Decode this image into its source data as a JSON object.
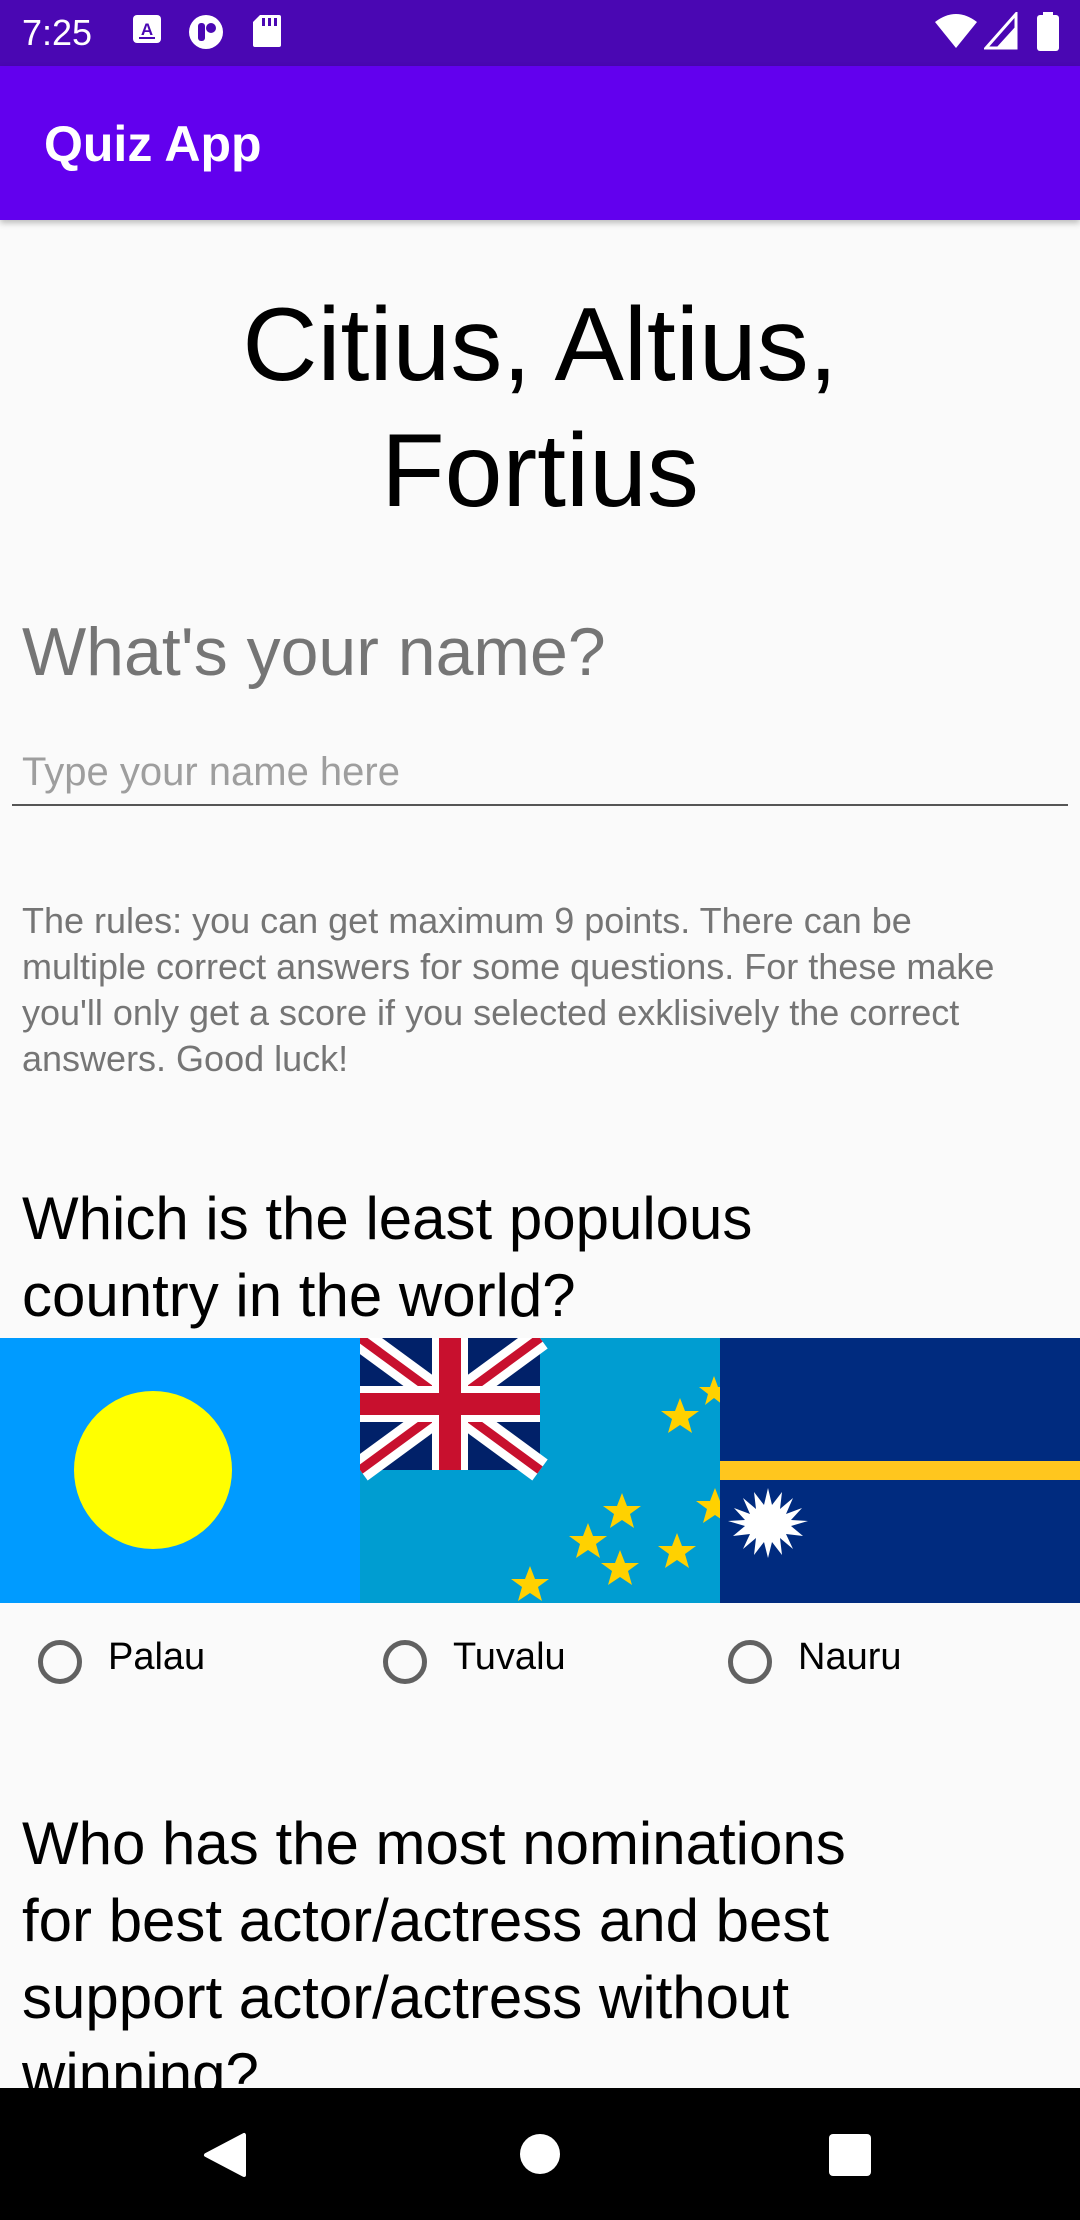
{
  "status_bar": {
    "time": "7:25",
    "left_icons": [
      "text-notification-icon",
      "app-notification-icon",
      "sd-card-icon"
    ],
    "right_icons": [
      "wifi-icon",
      "cell-signal-icon",
      "battery-icon"
    ]
  },
  "app_bar": {
    "title": "Quiz App"
  },
  "title": {
    "line1": "Citius, Altius,",
    "line2": "Fortius"
  },
  "name_section": {
    "question": "What's your name?",
    "placeholder": "Type your name here"
  },
  "rules": "The rules: you can get maximum 9 points. There can be multiple correct answers for some questions. For these make you'll only get a score if you selected exklisively the correct answers. Good luck!",
  "question1": {
    "line1": "Which is the least populous",
    "line2": "country in the world?",
    "options": [
      {
        "label": "Palau",
        "flag": "palau-flag",
        "selected": false
      },
      {
        "label": "Tuvalu",
        "flag": "tuvalu-flag",
        "selected": false
      },
      {
        "label": "Nauru",
        "flag": "nauru-flag",
        "selected": false
      }
    ]
  },
  "question2": {
    "line1": "Who has the most nominations",
    "line2": "for best actor/actress and best",
    "line3": "support actor/actress without",
    "line4": "winning?"
  },
  "nav_bar": {
    "buttons": [
      "back-icon",
      "home-icon",
      "recents-icon"
    ]
  },
  "colors": {
    "status_bar": "#4a07b3",
    "app_bar": "#6200ee",
    "palau_blue": "#009bff",
    "palau_moon": "#ffff00",
    "tuvalu_blue": "#009dd1",
    "nauru_blue": "#002b7f",
    "nauru_stripe": "#ffc61e"
  }
}
